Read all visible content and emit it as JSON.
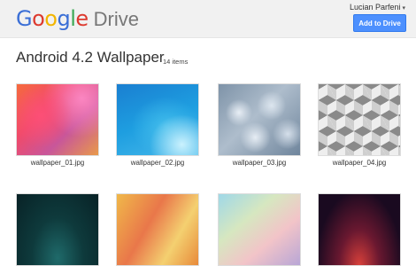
{
  "app": {
    "logo_letters": [
      {
        "char": "G",
        "color": "#3b6fd6"
      },
      {
        "char": "o",
        "color": "#dd3a2f"
      },
      {
        "char": "o",
        "color": "#f2b500"
      },
      {
        "char": "g",
        "color": "#3b6fd6"
      },
      {
        "char": "l",
        "color": "#3aa853"
      },
      {
        "char": "e",
        "color": "#dd3a2f"
      }
    ],
    "product": "Drive"
  },
  "header": {
    "user_name": "Lucian Parfeni",
    "user_caret": "▾",
    "add_button_label": "Add to Drive"
  },
  "folder": {
    "title": "Android 4.2 Wallpaper",
    "item_count": "14 items"
  },
  "files": [
    {
      "name": "wallpaper_01.jpg"
    },
    {
      "name": "wallpaper_02.jpg"
    },
    {
      "name": "wallpaper_03.jpg"
    },
    {
      "name": "wallpaper_04.jpg"
    },
    {
      "name": ""
    },
    {
      "name": ""
    },
    {
      "name": ""
    },
    {
      "name": ""
    }
  ]
}
